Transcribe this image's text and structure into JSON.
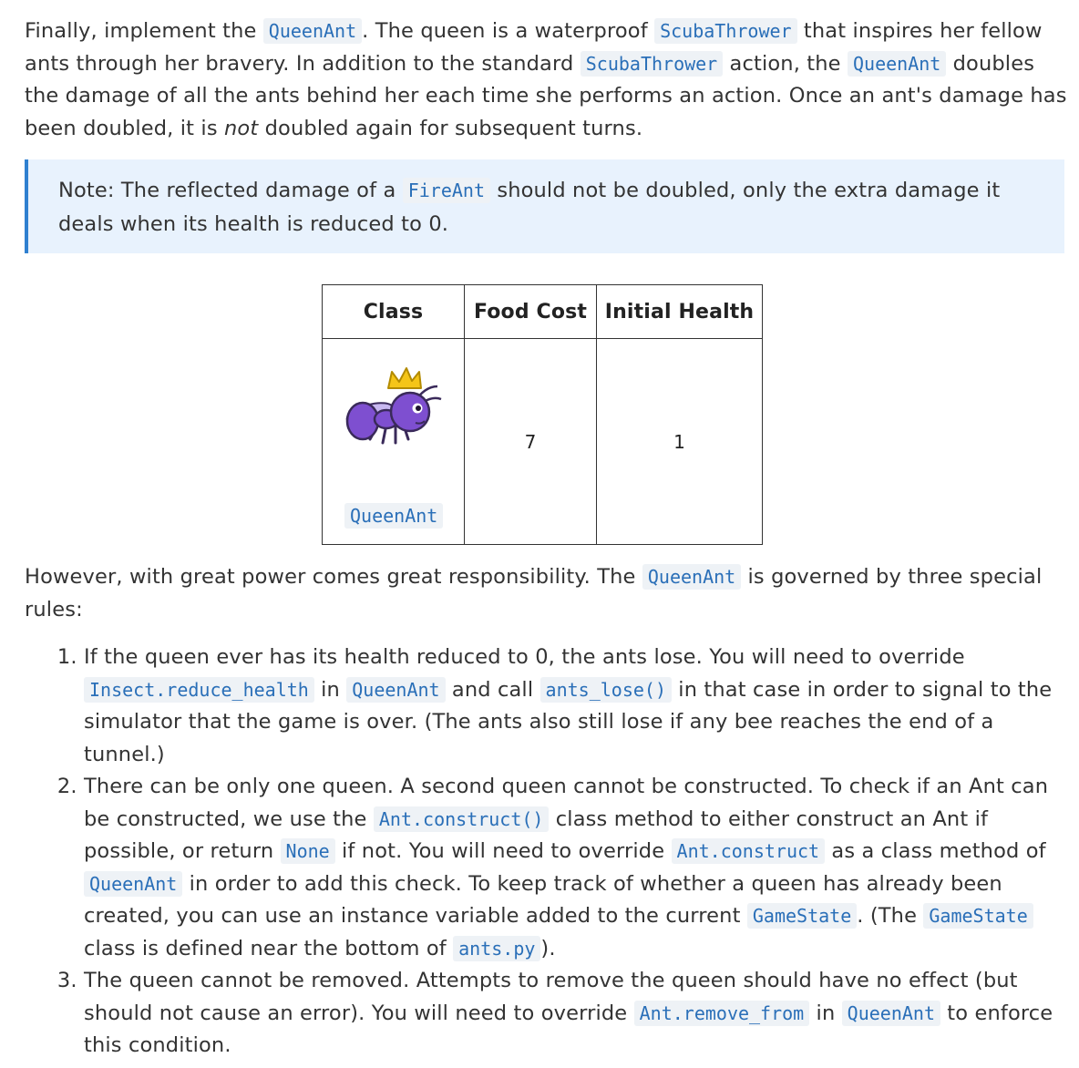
{
  "intro": {
    "t1": "Finally, implement the ",
    "c1": "QueenAnt",
    "t2": ". The queen is a waterproof ",
    "c2": "ScubaThrower",
    "t3": " that inspires her fellow ants through her bravery. In addition to the standard ",
    "c3": "ScubaThrower",
    "t4": " action, the ",
    "c4": "QueenAnt",
    "t5": " doubles the damage of all the ants behind her each time she performs an action. Once an ant's damage has been doubled, it is ",
    "em": "not",
    "t6": " doubled again for subsequent turns."
  },
  "note": {
    "t1": "Note: The reflected damage of a ",
    "c1": "FireAnt",
    "t2": " should not be doubled, only the extra damage it deals when its health is reduced to 0."
  },
  "table": {
    "headers": [
      "Class",
      "Food Cost",
      "Initial Health"
    ],
    "row": {
      "class_name": "QueenAnt",
      "food_cost": "7",
      "initial_health": "1"
    }
  },
  "power": {
    "t1": "However, with great power comes great responsibility. The ",
    "c1": "QueenAnt",
    "t2": " is governed by three special rules:"
  },
  "rules": [
    {
      "t1": "If the queen ever has its health reduced to 0, the ants lose. You will need to override ",
      "c1": "Insect.reduce_health",
      "t2": " in ",
      "c2": "QueenAnt",
      "t3": " and call ",
      "c3": "ants_lose()",
      "t4": " in that case in order to signal to the simulator that the game is over. (The ants also still lose if any bee reaches the end of a tunnel.)"
    },
    {
      "t1": "There can be only one queen. A second queen cannot be constructed. To check if an Ant can be constructed, we use the ",
      "c1": "Ant.construct()",
      "t2": " class method to either construct an Ant if possible, or return ",
      "c2": "None",
      "t3": " if not. You will need to override ",
      "c3": "Ant.construct",
      "t4": " as a class method of ",
      "c4": "QueenAnt",
      "t5": " in order to add this check. To keep track of whether a queen has already been created, you can use an instance variable added to the current ",
      "c5": "GameState",
      "t6": ". (The ",
      "c6": "GameState",
      "t7": " class is defined near the bottom of ",
      "c7": "ants.py",
      "t8": ")."
    },
    {
      "t1": "The queen cannot be removed. Attempts to remove the queen should have no effect (but should not cause an error). You will need to override ",
      "c1": "Ant.remove_from",
      "t2": " in ",
      "c2": "QueenAnt",
      "t3": " to enforce this condition."
    }
  ],
  "colors": {
    "code_text": "#2a6fb8",
    "code_bg": "#eef2f6",
    "note_bg": "#e8f2fd",
    "note_border": "#2f80d0",
    "ant_body": "#7e4fd0",
    "crown": "#f5c518"
  },
  "icons": {
    "queen_ant": "queen-ant-icon"
  }
}
